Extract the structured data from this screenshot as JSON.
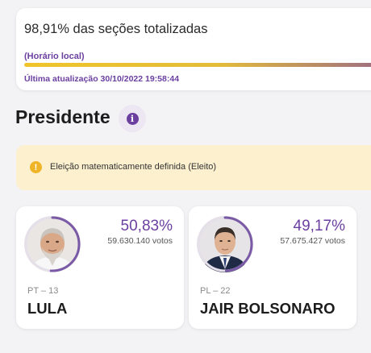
{
  "progress": {
    "title": "98,91% das seções totalizadas",
    "local_time": "(Horário local)",
    "fraction": 0.9891,
    "last_update": "Última atualização 30/10/2022 19:58:44"
  },
  "section": {
    "title": "Presidente",
    "info_icon": "info-icon"
  },
  "alert": {
    "icon": "warning-icon",
    "text": "Eleição matematicamente definida (Eleito)"
  },
  "candidates": [
    {
      "party": "PT – 13",
      "name": "LULA",
      "percent": "50,83%",
      "share": 0.5083,
      "votes": "59.630.140 votos"
    },
    {
      "party": "PL – 22",
      "name": "JAIR BOLSONARO",
      "percent": "49,17%",
      "share": 0.4917,
      "votes": "57.675.427 votos"
    }
  ],
  "colors": {
    "accent": "#6b3fa0",
    "progress_start": "#f0c52a",
    "alert_bg": "#fdf0cf",
    "alert_icon": "#f0b429"
  }
}
